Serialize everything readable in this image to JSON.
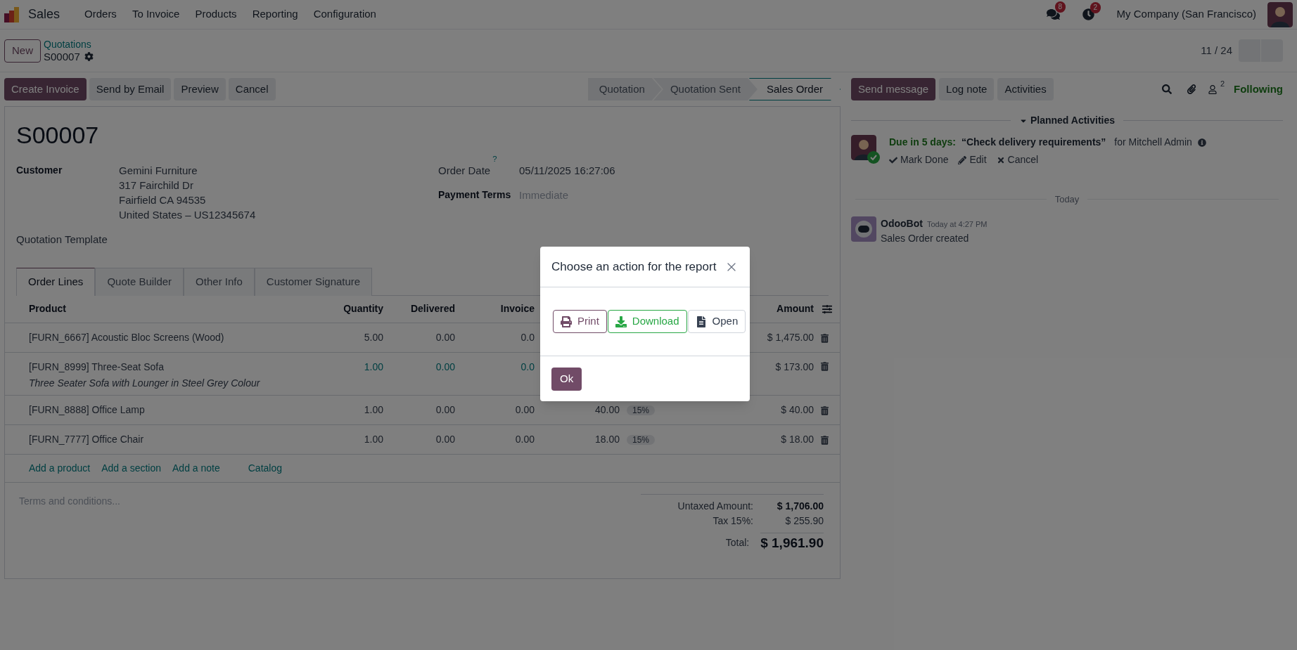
{
  "navbar": {
    "app": "Sales",
    "menus": [
      "Orders",
      "To Invoice",
      "Products",
      "Reporting",
      "Configuration"
    ],
    "messages_count": "8",
    "activities_count": "2",
    "company": "My Company (San Francisco)"
  },
  "breadcrumb": {
    "new_button": "New",
    "parent": "Quotations",
    "current": "S00007",
    "pager": "11 / 24"
  },
  "actions": [
    {
      "label": "Create Invoice",
      "kind": "primary"
    },
    {
      "label": "Send by Email",
      "kind": "secondary"
    },
    {
      "label": "Preview",
      "kind": "secondary"
    },
    {
      "label": "Cancel",
      "kind": "secondary"
    }
  ],
  "statusbar": [
    {
      "label": "Quotation",
      "selected": false
    },
    {
      "label": "Quotation Sent",
      "selected": false
    },
    {
      "label": "Sales Order",
      "selected": true
    }
  ],
  "form": {
    "title": "S00007",
    "customer_label": "Customer",
    "customer_lines": [
      "Gemini Furniture",
      "317 Fairchild Dr",
      "Fairfield CA 94535",
      "United States – US12345674"
    ],
    "order_date_label": "Order Date",
    "order_date_help": "?",
    "order_date": "05/11/2025 16:27:06",
    "payment_terms_label": "Payment Terms",
    "payment_terms": "Immediate",
    "template_label": "Quotation Template"
  },
  "tabs": [
    {
      "label": "Order Lines",
      "selected": true
    },
    {
      "label": "Quote Builder",
      "selected": false
    },
    {
      "label": "Other Info",
      "selected": false
    },
    {
      "label": "Customer Signature",
      "selected": false
    }
  ],
  "table": {
    "columns": [
      "Product",
      "Quantity",
      "Delivered",
      "Invoice",
      "Amount"
    ],
    "rows": [
      {
        "product": "[FURN_6667] Acoustic Bloc Screens (Wood)",
        "quantity": "5.00",
        "delivered": "0.00",
        "invoiced": "0.0",
        "amount": "$ 1,475.00",
        "emphasized": false
      },
      {
        "product": "[FURN_8999] Three-Seat Sofa",
        "description": "Three Seater Sofa with Lounger in Steel Grey Colour",
        "quantity": "1.00",
        "delivered": "0.00",
        "invoiced": "0.0",
        "amount": "$ 173.00",
        "emphasized": true
      },
      {
        "product": "[FURN_8888] Office Lamp",
        "quantity": "1.00",
        "delivered": "0.00",
        "invoiced": "0.00",
        "unit_price": "40.00",
        "tax": "15%",
        "amount": "$ 40.00",
        "emphasized": false
      },
      {
        "product": "[FURN_7777] Office Chair",
        "quantity": "1.00",
        "delivered": "0.00",
        "invoiced": "0.00",
        "unit_price": "18.00",
        "tax": "15%",
        "amount": "$ 18.00",
        "emphasized": false
      }
    ],
    "add_links": [
      "Add a product",
      "Add a section",
      "Add a note",
      "Catalog"
    ]
  },
  "terms_placeholder": "Terms and conditions...",
  "totals": [
    {
      "label": "Untaxed Amount:",
      "value": "$ 1,706.00",
      "kind": "subtotal"
    },
    {
      "label": "Tax 15%:",
      "value": "$ 255.90",
      "kind": "tax"
    },
    {
      "label": "Total:",
      "value": "$ 1,961.90",
      "kind": "total"
    }
  ],
  "chatter": {
    "buttons": [
      {
        "label": "Send message",
        "kind": "primary"
      },
      {
        "label": "Log note",
        "kind": "secondary"
      },
      {
        "label": "Activities",
        "kind": "secondary"
      }
    ],
    "followers_count": "2",
    "follow": "Following",
    "planned_title": "Planned Activities",
    "activity": {
      "due": "Due in 5 days:",
      "summary": "“Check delivery requirements”",
      "assignee": "for Mitchell Admin",
      "actions": [
        {
          "label": "Mark Done",
          "kind": "done"
        },
        {
          "label": "Edit",
          "kind": "edit"
        },
        {
          "label": "Cancel",
          "kind": "cancel"
        }
      ]
    },
    "separator": "Today",
    "message": {
      "author": "OdooBot",
      "time": "Today at 4:27 PM",
      "body": "Sales Order created"
    }
  },
  "dialog": {
    "title": "Choose an action for the report",
    "buttons": [
      {
        "label": "Print",
        "kind": "print"
      },
      {
        "label": "Download",
        "kind": "download"
      },
      {
        "label": "Open",
        "kind": "open"
      }
    ],
    "ok": "Ok"
  }
}
